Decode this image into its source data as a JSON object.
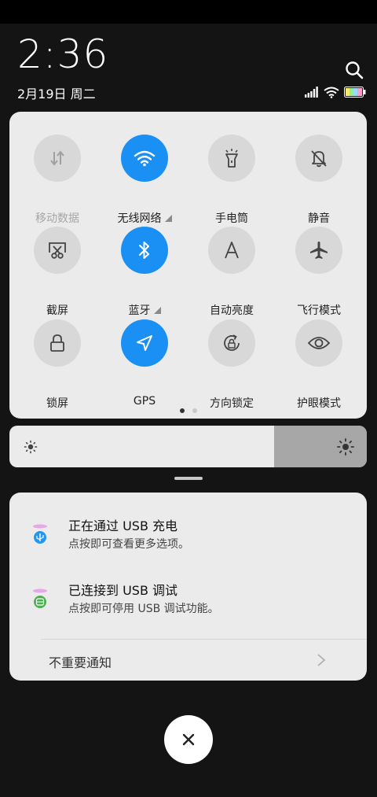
{
  "lockscreen": {
    "time": "2:36",
    "date": "2月19日 周二"
  },
  "quick_settings": {
    "tiles": [
      {
        "id": "mobile-data",
        "label": "移动数据",
        "active": false,
        "disabled": true
      },
      {
        "id": "wifi",
        "label": "无线网络",
        "active": true,
        "has_more": true
      },
      {
        "id": "flashlight",
        "label": "手电筒",
        "active": false
      },
      {
        "id": "mute",
        "label": "静音",
        "active": false
      },
      {
        "id": "screenshot",
        "label": "截屏",
        "active": false
      },
      {
        "id": "bluetooth",
        "label": "蓝牙",
        "active": true,
        "has_more": true
      },
      {
        "id": "auto-brightness",
        "label": "自动亮度",
        "active": false
      },
      {
        "id": "airplane",
        "label": "飞行模式",
        "active": false
      },
      {
        "id": "lock-screen",
        "label": "锁屏",
        "active": false
      },
      {
        "id": "gps",
        "label": "GPS",
        "active": true
      },
      {
        "id": "rotation-lock",
        "label": "方向锁定",
        "active": false
      },
      {
        "id": "eye-care",
        "label": "护眼模式",
        "active": false
      }
    ],
    "page_count": 2,
    "current_page": 1,
    "accent": "#1a90f5"
  },
  "brightness": {
    "level": 0.74
  },
  "notifications": [
    {
      "title": "正在通过 USB 充电",
      "text": "点按即可查看更多选项。",
      "icon": "usb-icon"
    },
    {
      "title": "已连接到 USB 调试",
      "text": "点按即可停用 USB 调试功能。",
      "icon": "android-debug-icon"
    }
  ],
  "unimportant_notifications": {
    "label": "不重要通知"
  }
}
